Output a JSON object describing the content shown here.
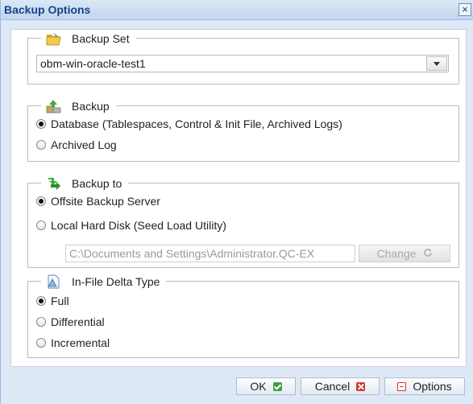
{
  "window": {
    "title": "Backup Options",
    "close_glyph": "×"
  },
  "backup_set": {
    "legend": "Backup Set",
    "icon": "folder-open-icon",
    "selected": "obm-win-oracle-test1"
  },
  "backup": {
    "legend": "Backup",
    "icon": "backup-upload-icon",
    "options": [
      {
        "label": "Database (Tablespaces, Control & Init File, Archived Logs)",
        "checked": true
      },
      {
        "label": "Archived Log",
        "checked": false
      }
    ]
  },
  "backup_to": {
    "legend": "Backup to",
    "icon": "backup-destination-icon",
    "options": [
      {
        "label": "Offsite Backup Server",
        "checked": true
      },
      {
        "label": "Local Hard Disk (Seed Load Utility)",
        "checked": false
      }
    ],
    "path_value": "C:\\Documents and Settings\\Administrator.QC-EX",
    "change_label": "Change"
  },
  "delta": {
    "legend": "In-File Delta Type",
    "icon": "delta-document-icon",
    "options": [
      {
        "label": "Full",
        "checked": true
      },
      {
        "label": "Differential",
        "checked": false
      },
      {
        "label": "Incremental",
        "checked": false
      }
    ]
  },
  "buttons": {
    "ok": "OK",
    "cancel": "Cancel",
    "options": "Options"
  },
  "colors": {
    "title_text": "#15428b",
    "dialog_bg": "#dfe8f6",
    "ok_icon": "#3fa03f",
    "cancel_icon": "#d9352b"
  }
}
